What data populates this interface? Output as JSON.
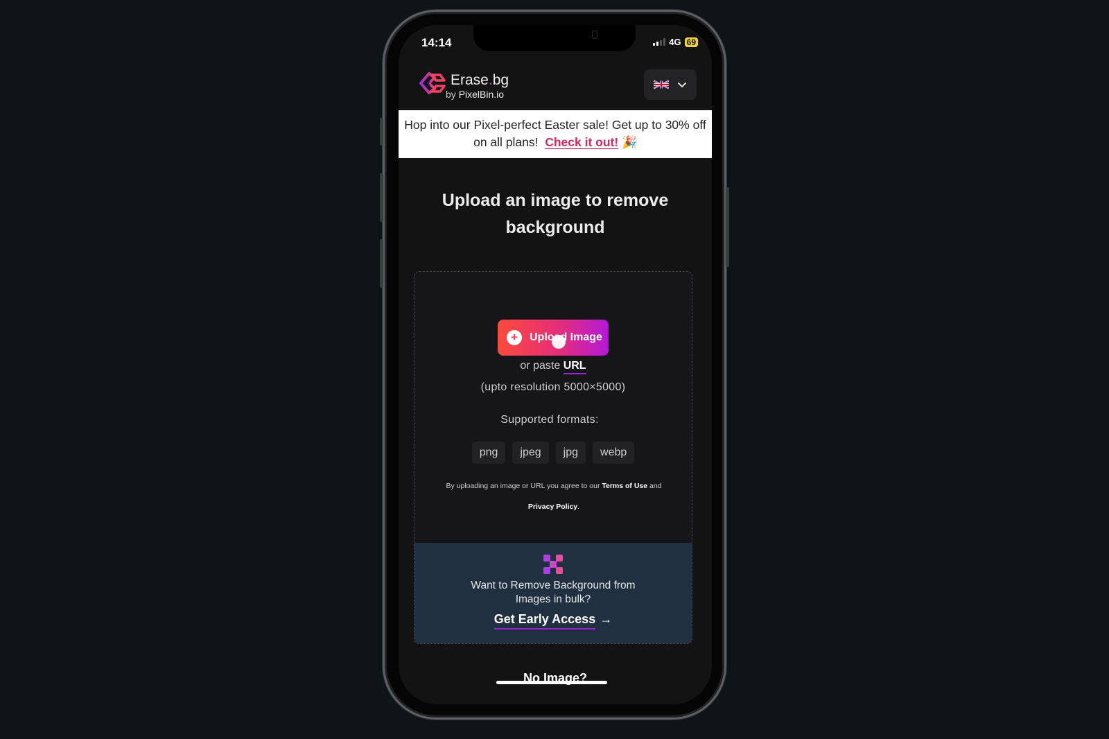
{
  "status_bar": {
    "time": "14:14",
    "network": "4G",
    "battery": "69"
  },
  "header": {
    "brand_name": "Erase",
    "brand_dot": ".",
    "brand_suffix": "bg",
    "by_label": "by",
    "by_company": "PixelBin.io",
    "language_flag": "🇬🇧",
    "language_chevron": "⌄"
  },
  "promo": {
    "text": "Hop into our Pixel-perfect Easter sale! Get up to 30% off on all plans!",
    "link_label": "Check it out!",
    "emoji": "🎉"
  },
  "main": {
    "title": "Upload an image to remove background",
    "upload_button_label": "Upload Image",
    "upload_icon": "+",
    "paste_prefix": "or paste",
    "paste_link": "URL",
    "resolution_note": "(upto resolution 5000×5000)",
    "formats_label": "Supported formats:",
    "formats": [
      "png",
      "jpeg",
      "jpg",
      "webp"
    ],
    "terms_prefix": "By uploading an image or URL you agree to our",
    "terms_link": "Terms of Use",
    "terms_and": "and",
    "privacy_link": "Privacy Policy",
    "terms_suffix": "."
  },
  "bulk": {
    "text": "Want to Remove Background from Images in bulk?",
    "cta_label": "Get Early Access",
    "cta_arrow": "→"
  },
  "footer": {
    "no_image_label": "No Image?"
  },
  "colors": {
    "accent_pink": "#d2295f",
    "accent_purple": "#9b23d6",
    "gradient_start": "#fb4a3c",
    "gradient_end": "#b31ad7",
    "bulk_bg": "#213040"
  }
}
